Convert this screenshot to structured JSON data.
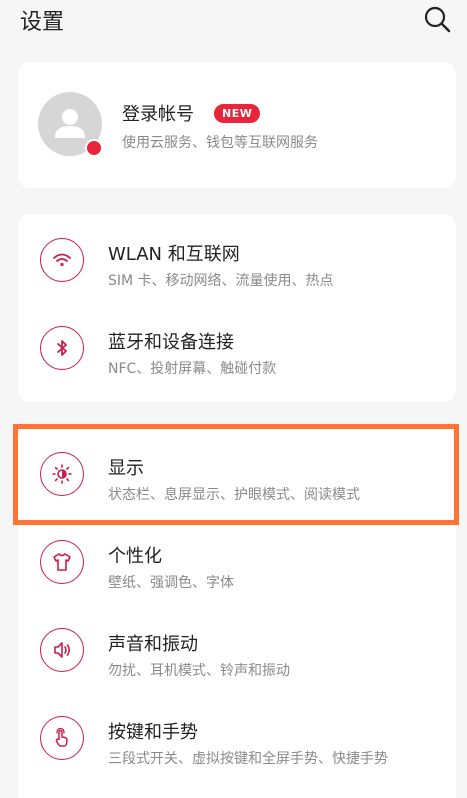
{
  "header": {
    "title": "设置",
    "search_icon": "search-icon"
  },
  "account": {
    "title": "登录帐号",
    "badge": "NEW",
    "subtitle": "使用云服务、钱包等互联网服务",
    "avatar_icon": "user-avatar-icon",
    "dot_color": "#e8253a"
  },
  "items": [
    {
      "title": "WLAN 和互联网",
      "subtitle": "SIM 卡、移动网络、流量使用、热点",
      "icon": "wifi-icon"
    },
    {
      "title": "蓝牙和设备连接",
      "subtitle": "NFC、投射屏幕、触碰付款",
      "icon": "bluetooth-icon"
    },
    {
      "title": "显示",
      "subtitle": "状态栏、息屏显示、护眼模式、阅读模式",
      "icon": "brightness-icon"
    },
    {
      "title": "个性化",
      "subtitle": "壁纸、强调色、字体",
      "icon": "tshirt-icon"
    },
    {
      "title": "声音和振动",
      "subtitle": "勿扰、耳机模式、铃声和振动",
      "icon": "speaker-icon"
    },
    {
      "title": "按键和手势",
      "subtitle": "三段式开关、虚拟按键和全屏手势、快捷手势",
      "icon": "gesture-icon"
    }
  ],
  "colors": {
    "accent": "#cc1c4c",
    "badge": "#e8253a",
    "highlight": "#ff7336",
    "background": "#f6f6f6"
  }
}
